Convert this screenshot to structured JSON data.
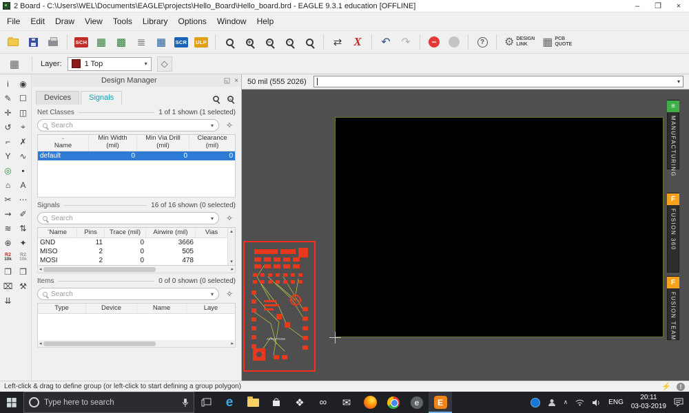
{
  "window": {
    "title": "2 Board - C:\\Users\\WEL\\Documents\\EAGLE\\projects\\Hello_Board\\Hello_board.brd - EAGLE 9.3.1 education [OFFLINE]"
  },
  "icons": {
    "minimize": "–",
    "maximize": "❐",
    "close": "×",
    "sheet": "▦",
    "chart": "▩",
    "layers": "≣",
    "cam": "▦",
    "grid": "▦",
    "swap": "⇄",
    "cancel_x": "X",
    "undo": "↶",
    "redo": "↷",
    "stop_minus": "−",
    "help": "?",
    "plus": "+",
    "minus": "−",
    "dot": "·",
    "redraw": "↻",
    "gear": "⚙",
    "quote": "▦",
    "tag": "◇",
    "dropdown": "▾",
    "float": "◱",
    "panel_close": "×",
    "sort": "ˆ",
    "scroll_up": "▴",
    "scroll_down": "▾",
    "scroll_left": "◂",
    "scroll_right": "▸",
    "wand": "✧",
    "bolt": "⚡",
    "warn": "!",
    "chevron_up": "∧",
    "dropbox": "❖",
    "infinity": "∞",
    "mail": "✉",
    "edge": "e",
    "browser2": "e",
    "eagle": "E",
    "manufacturing": "≡",
    "fusion": "F"
  },
  "menubar": {
    "items": [
      "File",
      "Edit",
      "Draw",
      "View",
      "Tools",
      "Library",
      "Options",
      "Window",
      "Help"
    ]
  },
  "toolbar": {
    "sch": "SCH",
    "scr": "SCR",
    "ulp": "ULP",
    "design_link_1": "DESIGN",
    "design_link_2": "LINK",
    "pcb_quote_1": "PCB",
    "pcb_quote_2": "QUOTE"
  },
  "layerbar": {
    "label": "Layer:",
    "value": "1 Top"
  },
  "left_toolbar": [
    {
      "name": "info-tool-icon",
      "glyph": "i"
    },
    {
      "name": "show-tool-icon",
      "glyph": "◉"
    },
    {
      "name": "display-tool-icon",
      "glyph": "✎"
    },
    {
      "name": "group-tool-icon",
      "glyph": "☐"
    },
    {
      "name": "move-tool-icon",
      "glyph": "✛"
    },
    {
      "name": "mirror-tool-icon",
      "glyph": "◫"
    },
    {
      "name": "rotate-tool-icon",
      "glyph": "↺"
    },
    {
      "name": "mark-tool-icon",
      "glyph": "⌖"
    },
    {
      "name": "wire-tool-icon",
      "glyph": "⌐"
    },
    {
      "name": "delete-tool-icon",
      "glyph": "✗"
    },
    {
      "name": "split-tool-icon",
      "glyph": "Y"
    },
    {
      "name": "route-tool-icon",
      "glyph": "∿"
    },
    {
      "name": "via-tool-icon",
      "glyph": "◎"
    },
    {
      "name": "smd-tool-icon",
      "glyph": "▪"
    },
    {
      "name": "polygon-tool-icon",
      "glyph": "⌂"
    },
    {
      "name": "text-tool-icon",
      "glyph": "A"
    },
    {
      "name": "cut-tool-icon",
      "glyph": "✂"
    },
    {
      "name": "optimize-tool-icon",
      "glyph": "⋯"
    },
    {
      "name": "airwire-tool-icon",
      "glyph": "⇝"
    },
    {
      "name": "draw-tool-icon",
      "glyph": "✐"
    },
    {
      "name": "ratsnest-tool-icon",
      "glyph": "≋"
    },
    {
      "name": "signal-tool-icon",
      "glyph": "⇅"
    },
    {
      "name": "glue-tool-icon",
      "glyph": "⊕"
    },
    {
      "name": "drill-tool-icon",
      "glyph": "✦"
    },
    {
      "name": "smash-tool-icon",
      "glyph": "R2",
      "sub": "10k"
    },
    {
      "name": "unsmash-tool-icon",
      "glyph": "R2",
      "sub": "10k"
    },
    {
      "name": "copy-tool-icon",
      "glyph": "❐"
    },
    {
      "name": "paste-tool-icon",
      "glyph": "❒"
    },
    {
      "name": "erase-tool-icon",
      "glyph": "⌧"
    },
    {
      "name": "wrench-tool-icon",
      "glyph": "⚒"
    },
    {
      "name": "collapse-tools-icon",
      "glyph": "⇊"
    }
  ],
  "design_manager": {
    "title": "Design Manager",
    "tabs": [
      "Devices",
      "Signals"
    ],
    "net_classes": {
      "label": "Net Classes",
      "count": "1 of 1 shown (1 selected)",
      "search_placeholder": "Search",
      "columns": [
        {
          "label": "Name",
          "unit": ""
        },
        {
          "label": "Min Width",
          "unit": "(mil)"
        },
        {
          "label": "Min Via Drill",
          "unit": "(mil)"
        },
        {
          "label": "Clearance",
          "unit": "(mil)"
        }
      ],
      "rows": [
        {
          "name": "default",
          "min_width": "0",
          "min_via_drill": "0",
          "clearance": "0"
        }
      ]
    },
    "signals": {
      "label": "Signals",
      "count": "16 of 16 shown (0 selected)",
      "search_placeholder": "Search",
      "columns": [
        "Name",
        "Pins",
        "Trace (mil)",
        "Airwire (mil)",
        "Vias"
      ],
      "rows": [
        {
          "name": "GND",
          "pins": "11",
          "trace": "0",
          "airwire": "3666"
        },
        {
          "name": "MISO",
          "pins": "2",
          "trace": "0",
          "airwire": "505"
        },
        {
          "name": "MOSI",
          "pins": "2",
          "trace": "0",
          "airwire": "478"
        }
      ]
    },
    "items": {
      "label": "Items",
      "count": "0 of 0 shown (0 selected)",
      "search_placeholder": "Search",
      "columns": [
        "Type",
        "Device",
        "Name",
        "Laye"
      ]
    }
  },
  "canvas": {
    "coordinates": "50 mil (555 2026)",
    "command_value": "",
    "board_label": "AVRISP/GND"
  },
  "right_rail": {
    "tabs": [
      {
        "label": "MANUFACTURING"
      },
      {
        "label": "FUSION 360"
      },
      {
        "label": "FUSION TEAM"
      }
    ]
  },
  "statusbar": {
    "text": "Left-click & drag to define group (or left-click to start defining a group polygon)"
  },
  "taskbar": {
    "search_placeholder": "Type here to search",
    "language": "ENG",
    "time": "20:11",
    "date": "03-03-2019"
  }
}
